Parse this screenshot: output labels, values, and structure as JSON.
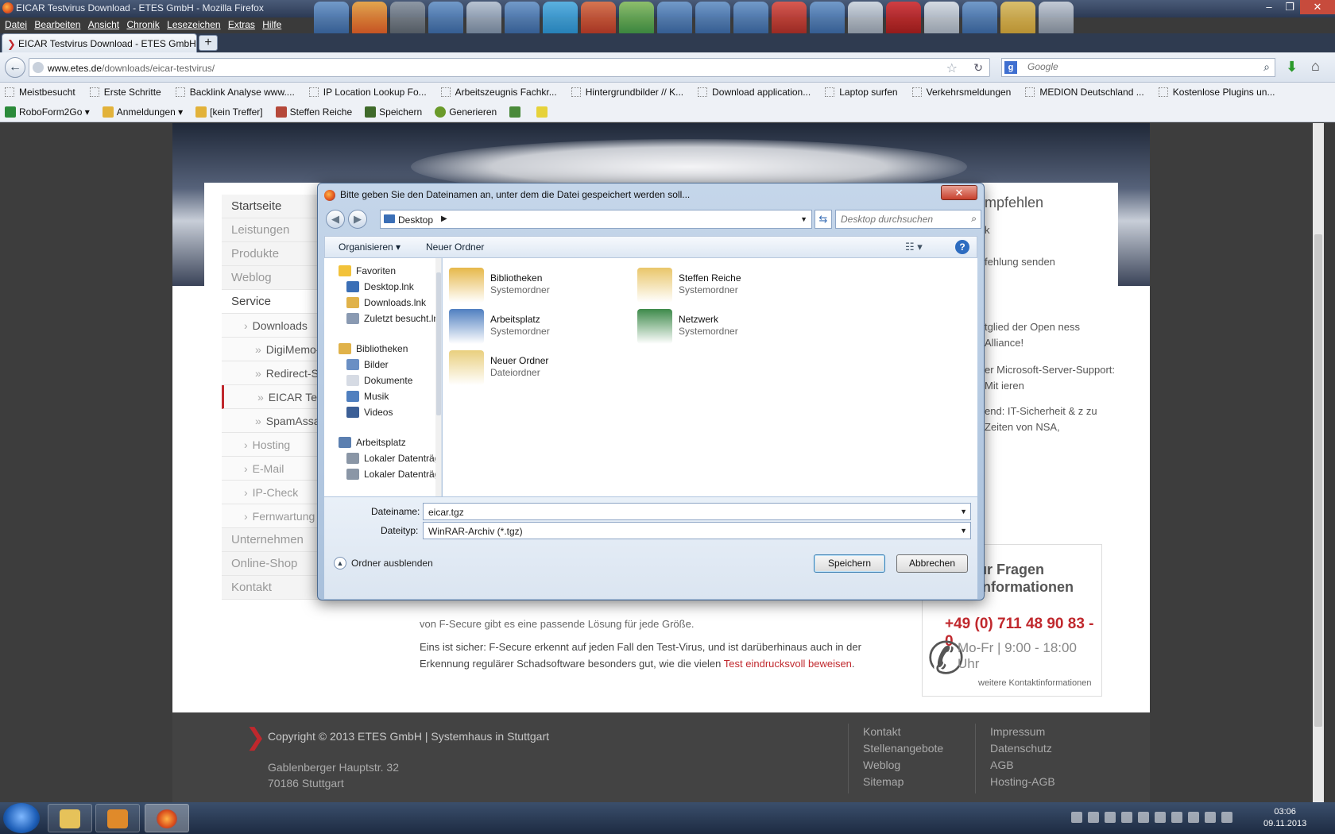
{
  "window": {
    "title": "EICAR Testvirus Download - ETES GmbH - Mozilla Firefox",
    "controls": [
      "–",
      "❐",
      "✕"
    ]
  },
  "menu": [
    "Datei",
    "Bearbeiten",
    "Ansicht",
    "Chronik",
    "Lesezeichen",
    "Extras",
    "Hilfe"
  ],
  "tab": {
    "label": "EICAR Testvirus Download - ETES GmbH",
    "new_tab": "+"
  },
  "address": {
    "host": "www.etes.de",
    "path": "/downloads/eicar-testvirus/"
  },
  "search": {
    "engine": "g",
    "placeholder": "Google"
  },
  "bookmarks": [
    "Meistbesucht",
    "Erste Schritte",
    "Backlink Analyse www....",
    "IP Location Lookup Fo...",
    "Arbeitszeugnis Fachkr...",
    "Hintergrundbilder // K...",
    "Download application...",
    "Laptop surfen",
    "Verkehrsmeldungen",
    "MEDION Deutschland ...",
    "Kostenlose Plugins un..."
  ],
  "roboform": [
    "RoboForm2Go ▾",
    "Anmeldungen ▾",
    "[kein Treffer]",
    "Steffen Reiche",
    "Speichern",
    "Generieren"
  ],
  "site": {
    "nav": [
      {
        "label": "Startseite",
        "kind": "main"
      },
      {
        "label": "Leistungen",
        "kind": "gray"
      },
      {
        "label": "Produkte",
        "kind": "gray"
      },
      {
        "label": "Weblog",
        "kind": "gray"
      },
      {
        "label": "Service",
        "kind": "active"
      },
      {
        "label": "Downloads",
        "kind": "sub"
      },
      {
        "label": "DigiMemo-K",
        "kind": "sub2"
      },
      {
        "label": "Redirect-Scr",
        "kind": "sub2"
      },
      {
        "label": "EICAR Testvi",
        "kind": "sub2sel"
      },
      {
        "label": "SpamAssass",
        "kind": "sub2"
      },
      {
        "label": "Hosting",
        "kind": "subgray"
      },
      {
        "label": "E-Mail",
        "kind": "subgray"
      },
      {
        "label": "IP-Check",
        "kind": "subgray"
      },
      {
        "label": "Fernwartung",
        "kind": "subgray"
      },
      {
        "label": "Unternehmen",
        "kind": "gray"
      },
      {
        "label": "Online-Shop",
        "kind": "gray"
      },
      {
        "label": "Kontakt",
        "kind": "gray"
      }
    ],
    "right": {
      "heading": "mpfehlen",
      "line1": "k",
      "line2": "fehlung senden",
      "p1": "tglied der Open ness Alliance!",
      "p2": "er Microsoft-Server-Support: Mit ieren",
      "p3": "end: IT-Sicherheit & z zu Zeiten von NSA,"
    },
    "contact": {
      "title": "ur Fragen Informationen",
      "phone": "+49 (0) 711 48 90 83 - 0",
      "hours": "Mo-Fr | 9:00 - 18:00 Uhr",
      "more": "weitere Kontaktinformationen"
    },
    "body": {
      "cut_line": "von F-Secure gibt es eine passende Lösung für jede Größe.",
      "para": "Eins ist sicher: F-Secure erkennt auf jeden Fall den Test-Virus, und ist darüberhinaus auch in der Erkennung regulärer Schadsoftware besonders gut, wie die vielen ",
      "link": "Test eindrucksvoll beweisen",
      "end": "."
    },
    "footer": {
      "copyright": "Copyright © 2013 ETES GmbH | Systemhaus in Stuttgart",
      "street": "Gablenberger Hauptstr. 32",
      "city": "70186 Stuttgart",
      "col1": [
        "Kontakt",
        "Stellenangebote",
        "Weblog",
        "Sitemap"
      ],
      "col2": [
        "Impressum",
        "Datenschutz",
        "AGB",
        "Hosting-AGB"
      ]
    }
  },
  "dialog": {
    "title": "Bitte geben Sie den Dateinamen an, unter dem die Datei gespeichert werden soll...",
    "location": "Desktop",
    "search_placeholder": "Desktop durchsuchen",
    "organize": "Organisieren ▾",
    "new_folder": "Neuer Ordner",
    "nav": [
      {
        "label": "Favoriten",
        "indent": 0,
        "color": "#f2c23a"
      },
      {
        "label": "Desktop.lnk",
        "indent": 1,
        "color": "#3b6fb6"
      },
      {
        "label": "Downloads.lnk",
        "indent": 1,
        "color": "#e0b24a"
      },
      {
        "label": "Zuletzt besucht.lnk",
        "indent": 1,
        "color": "#8a9ab2"
      },
      {
        "label": "",
        "indent": 0,
        "color": ""
      },
      {
        "label": "Bibliotheken",
        "indent": 0,
        "color": "#e0b24a"
      },
      {
        "label": "Bilder",
        "indent": 1,
        "color": "#6a8fc4"
      },
      {
        "label": "Dokumente",
        "indent": 1,
        "color": "#d6dbe4"
      },
      {
        "label": "Musik",
        "indent": 1,
        "color": "#4f7fbf"
      },
      {
        "label": "Videos",
        "indent": 1,
        "color": "#3c5f96"
      },
      {
        "label": "",
        "indent": 0,
        "color": ""
      },
      {
        "label": "Arbeitsplatz",
        "indent": 0,
        "color": "#5b7fb0"
      },
      {
        "label": "Lokaler Datenträger",
        "indent": 1,
        "color": "#8a96a6"
      },
      {
        "label": "Lokaler Datenträger",
        "indent": 1,
        "color": "#8a96a6"
      }
    ],
    "items": [
      {
        "name": "Bibliotheken",
        "type": "Systemordner",
        "color": "#e6b84a"
      },
      {
        "name": "Steffen Reiche",
        "type": "Systemordner",
        "color": "#e9c66a"
      },
      {
        "name": "Arbeitsplatz",
        "type": "Systemordner",
        "color": "#4f7fc0"
      },
      {
        "name": "Netzwerk",
        "type": "Systemordner",
        "color": "#3d8a4a"
      },
      {
        "name": "Neuer Ordner",
        "type": "Dateiordner",
        "color": "#e9cf7e"
      }
    ],
    "filename_label": "Dateiname:",
    "filename": "eicar.tgz",
    "filetype_label": "Dateityp:",
    "filetype": "WinRAR-Archiv (*.tgz)",
    "hide_folders": "Ordner ausblenden",
    "save": "Speichern",
    "cancel": "Abbrechen"
  },
  "taskbar": {
    "time": "03:06",
    "date": "09.11.2013"
  }
}
